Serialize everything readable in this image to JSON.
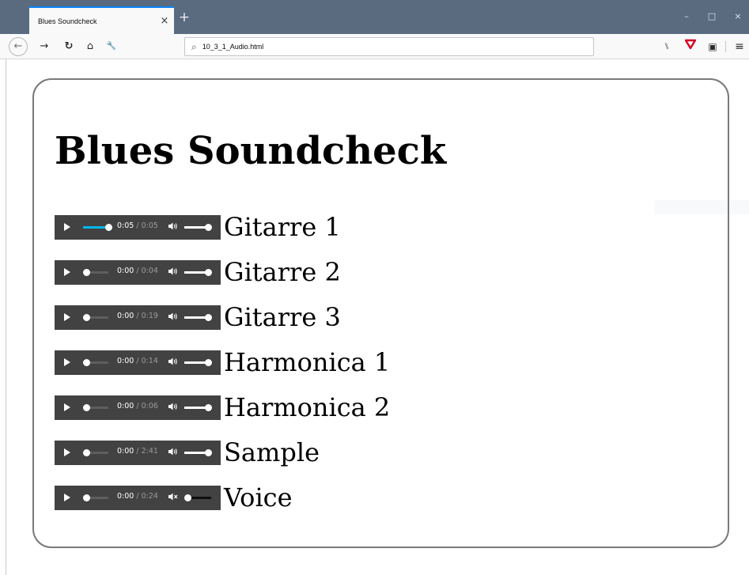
{
  "browser": {
    "tab_title": "Blues Soundcheck",
    "tab_close": "×",
    "new_tab": "+",
    "window_controls": [
      "–",
      "□",
      "×"
    ],
    "nav_icons": [
      "back-icon",
      "forward-icon",
      "reload-icon",
      "home-icon",
      "wrench-icon"
    ],
    "nav_glyphs": {
      "back": "←",
      "forward": "→",
      "reload": "↻",
      "home": "⌂",
      "tools": "🔧",
      "search": "⌕"
    },
    "url": "10_3_1_Audio.html",
    "toolbar_glyphs": {
      "library": "⑊",
      "shield": "♥",
      "sidebar": "▣",
      "menu": "≡"
    },
    "accent_color": "#0a84ff"
  },
  "page": {
    "title": "Blues Soundcheck",
    "tracks": [
      {
        "label": "Gitarre 1",
        "current": "0:05",
        "duration": "0:05",
        "progress": 1.0,
        "volume": 1.0,
        "muted": false
      },
      {
        "label": "Gitarre 2",
        "current": "0:00",
        "duration": "0:04",
        "progress": 0.0,
        "volume": 1.0,
        "muted": false
      },
      {
        "label": "Gitarre 3",
        "current": "0:00",
        "duration": "0:19",
        "progress": 0.0,
        "volume": 1.0,
        "muted": false
      },
      {
        "label": "Harmonica 1",
        "current": "0:00",
        "duration": "0:14",
        "progress": 0.0,
        "volume": 1.0,
        "muted": false
      },
      {
        "label": "Harmonica 2",
        "current": "0:00",
        "duration": "0:06",
        "progress": 0.0,
        "volume": 1.0,
        "muted": false
      },
      {
        "label": "Sample",
        "current": "0:00",
        "duration": "2:41",
        "progress": 0.0,
        "volume": 1.0,
        "muted": false
      },
      {
        "label": "Voice",
        "current": "0:00",
        "duration": "0:24",
        "progress": 0.0,
        "volume": 0.0,
        "muted": true
      }
    ],
    "player_colors": {
      "background": "#424242",
      "progress": "#00b6f0",
      "knob": "#ffffff"
    }
  }
}
